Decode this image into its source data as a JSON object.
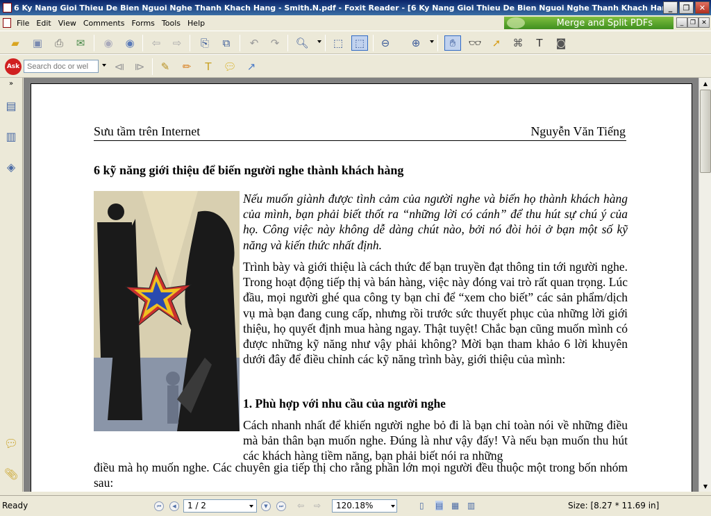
{
  "window": {
    "title": "6 Ky Nang Gioi Thieu De Bien Nguoi Nghe Thanh Khach Hang - Smith.N.pdf - Foxit Reader - [6 Ky Nang Gioi Thieu De Bien Nguoi Nghe Thanh Khach Hang - Smith.N.pdf]"
  },
  "menu": [
    "File",
    "Edit",
    "View",
    "Comments",
    "Forms",
    "Tools",
    "Help"
  ],
  "banner": {
    "label": "Merge and Split PDFs"
  },
  "search": {
    "placeholder": "Search doc or wel"
  },
  "status": {
    "ready": "Ready",
    "page": "1 / 2",
    "zoom": "120.18%",
    "size": "Size: [8.27 * 11.69 in]"
  },
  "doc": {
    "header_left": "Sưu tầm trên Internet",
    "header_right": "Nguyễn Văn Tiếng",
    "title": "6 kỹ năng giới thiệu để biến người nghe thành khách hàng",
    "intro": "Nếu muốn giành được tình cảm của người nghe và biến họ thành khách hàng của mình, bạn phải biết thốt ra “những lời có cánh” để thu hút sự chú ý của họ. Công việc này không dễ dàng chút nào, bởi nó đòi hỏi ở bạn một số kỹ năng và kiến thức nhất định.",
    "p1": "Trình bày và giới thiệu là cách thức để bạn truyền đạt thông tin tới người nghe. Trong hoạt động tiếp thị và bán hàng, việc này đóng vai trò rất quan trọng. Lúc đầu, mọi người ghé qua công ty bạn chỉ để “xem cho biết” các sản phẩm/dịch vụ mà bạn đang cung cấp, nhưng rồi trước sức thuyết phục của những lời giới thiệu, họ quyết định mua hàng ngay. Thật tuyệt! Chắc bạn cũng muốn mình có được những kỹ năng như vậy phải không? Mời bạn tham khảo 6 lời khuyên dưới đây để điều chỉnh các kỹ năng trình bày, giới thiệu của mình:",
    "h1": "1. Phù hợp với nhu cầu của người nghe",
    "p2a": "Cách nhanh nhất để khiến người nghe bỏ đi là bạn chỉ toàn nói về những điều mà bản thân bạn muốn nghe. Đúng là như vậy đấy! Và nếu bạn muốn thu hút các khách hàng tiềm năng, bạn phải biết nói ra những",
    "p2b": "điều mà họ muốn nghe. Các chuyên gia tiếp thị cho rằng phần lớn mọi người đều thuộc một trong bốn nhóm sau:"
  }
}
